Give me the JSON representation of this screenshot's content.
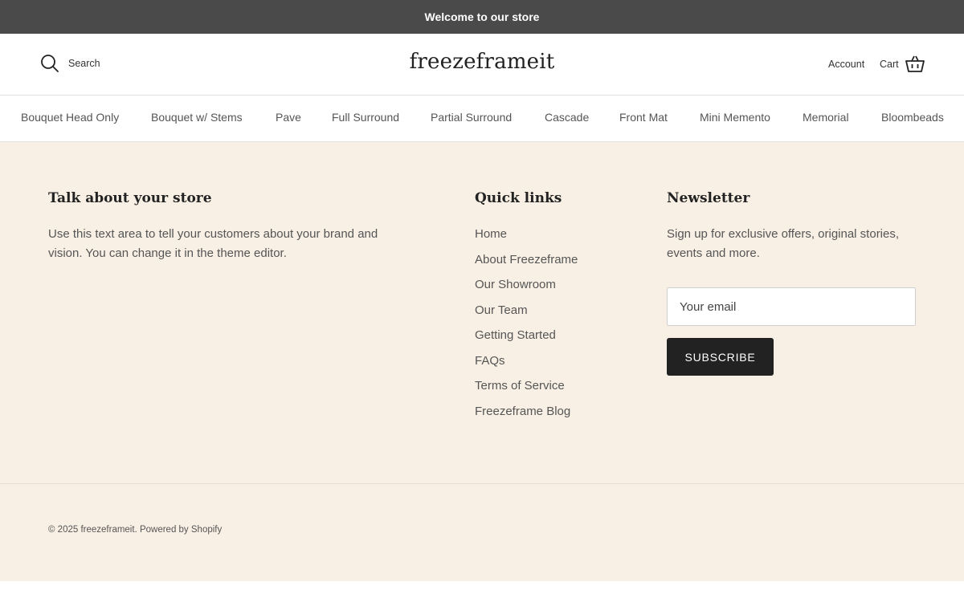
{
  "announcement": {
    "text": "Welcome to our store"
  },
  "header": {
    "search_label": "Search",
    "logo": "freezeframeit",
    "account_label": "Account",
    "cart_label": "Cart"
  },
  "nav": {
    "items": [
      {
        "label": "Bouquet Head Only"
      },
      {
        "label": "Bouquet w/ Stems"
      },
      {
        "label": "Pave"
      },
      {
        "label": "Full Surround"
      },
      {
        "label": "Partial Surround"
      },
      {
        "label": "Cascade"
      },
      {
        "label": "Front Mat"
      },
      {
        "label": "Mini Memento"
      },
      {
        "label": "Memorial"
      },
      {
        "label": "Bloombeads"
      }
    ]
  },
  "footer": {
    "about": {
      "title": "Talk about your store",
      "text": "Use this text area to tell your customers about your brand and vision. You can change it in the theme editor."
    },
    "quick_links": {
      "title": "Quick links",
      "items": [
        {
          "label": "Home"
        },
        {
          "label": "About Freezeframe"
        },
        {
          "label": "Our Showroom"
        },
        {
          "label": "Our Team"
        },
        {
          "label": "Getting Started"
        },
        {
          "label": "FAQs"
        },
        {
          "label": "Terms of Service"
        },
        {
          "label": "Freezeframe Blog"
        }
      ]
    },
    "newsletter": {
      "title": "Newsletter",
      "text": "Sign up for exclusive offers, original stories, events and more.",
      "email_placeholder": "Your email",
      "email_value": "",
      "subscribe_label": "SUBSCRIBE"
    },
    "copyright": {
      "prefix": "© 2025 ",
      "store_link": "freezeframeit",
      "separator": ". ",
      "powered_by": "Powered by Shopify"
    }
  },
  "colors": {
    "announcement_bg": "#4a4a4a",
    "footer_bg": "#f8f0e5",
    "button_bg": "#222222"
  },
  "icons": [
    "search-icon",
    "cart-basket-icon"
  ]
}
